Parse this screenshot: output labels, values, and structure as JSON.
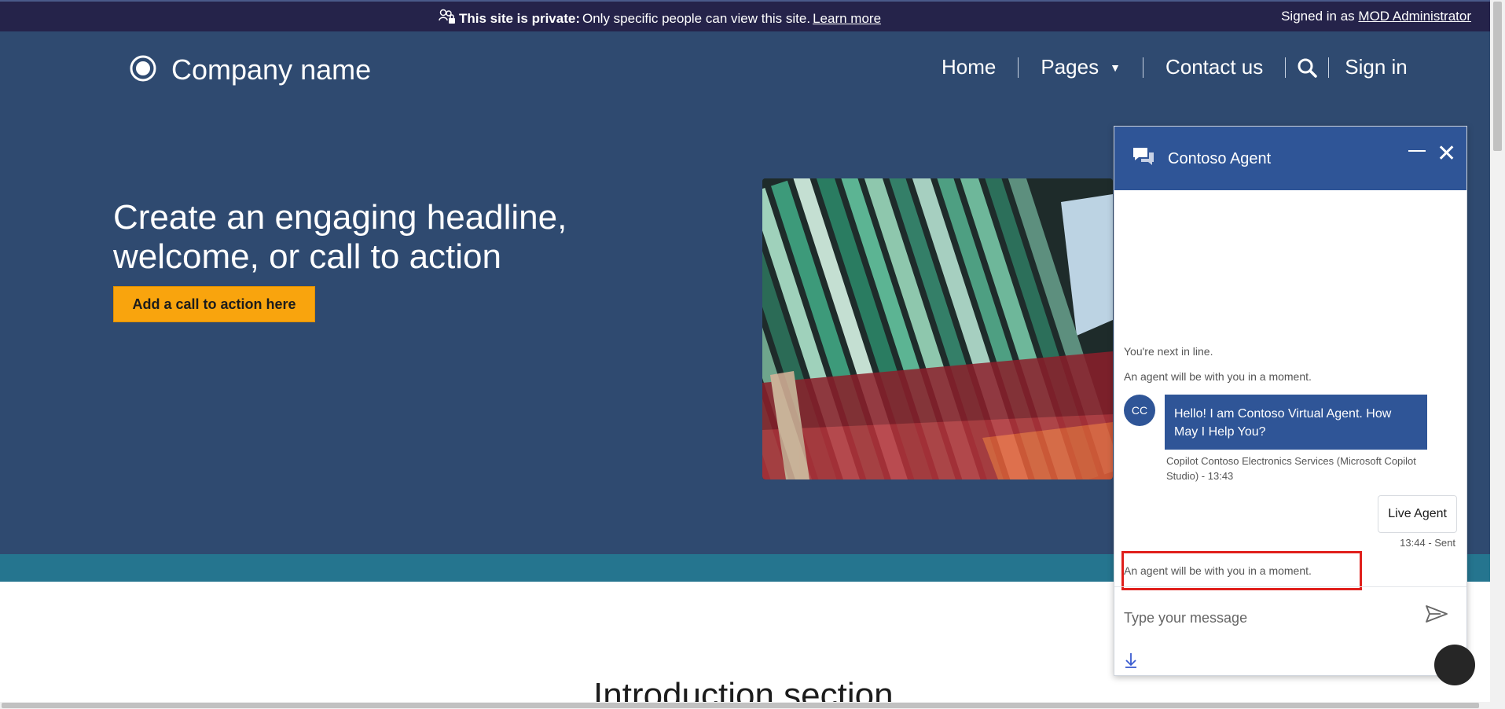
{
  "privacy_banner": {
    "bold_text": "This site is private:",
    "text": "Only specific people can view this site.",
    "link": "Learn more",
    "signed_in_prefix": "Signed in as",
    "user_name": "MOD Administrator"
  },
  "header": {
    "company_name": "Company name",
    "nav": {
      "home": "Home",
      "pages": "Pages",
      "contact": "Contact us",
      "sign_in": "Sign in"
    }
  },
  "hero": {
    "headline": "Create an engaging headline, welcome, or call to action",
    "cta_label": "Add a call to action here"
  },
  "intro": {
    "heading": "Introduction section"
  },
  "chat": {
    "title": "Contoso Agent",
    "messages": {
      "queue_text": "You're next in line.",
      "agent_wait_1": "An agent will be with you in a moment.",
      "avatar_initials": "CC",
      "bot_message": "Hello! I am Contoso Virtual Agent. How May I Help You?",
      "bot_meta": "Copilot Contoso Electronics Services (Microsoft Copilot Studio) - 13:43",
      "user_message": "Live Agent",
      "user_meta": "13:44 - Sent",
      "agent_wait_2": "An agent will be with you in a moment."
    },
    "input_placeholder": "Type your message"
  },
  "colors": {
    "banner_bg": "#25234a",
    "hero_bg": "#2f4a70",
    "cta_bg": "#f9a40d",
    "teal_band": "#25758f",
    "chat_header": "#2f5597",
    "highlight_border": "#e0201c"
  },
  "icons": [
    "people-lock-icon",
    "logo-ring-icon",
    "search-icon",
    "chevron-down-icon",
    "chat-bubbles-icon",
    "minimize-icon",
    "close-icon",
    "send-icon",
    "download-icon",
    "speaker-icon"
  ]
}
